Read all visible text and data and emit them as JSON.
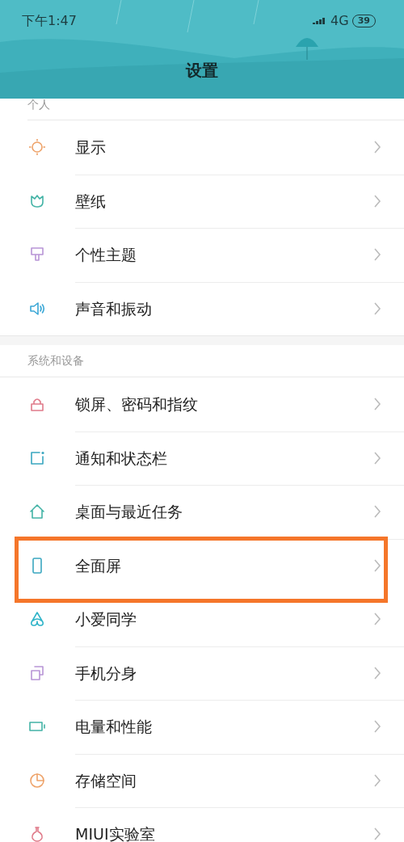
{
  "status_bar": {
    "time": "下午1:47",
    "network": "4G",
    "battery": "39"
  },
  "title": "设置",
  "sections": [
    {
      "label": "个人",
      "items": [
        {
          "label": "显示",
          "highlighted": false
        },
        {
          "label": "壁纸",
          "highlighted": false
        },
        {
          "label": "个性主题",
          "highlighted": false
        },
        {
          "label": "声音和振动",
          "highlighted": false
        }
      ]
    },
    {
      "label": "系统和设备",
      "items": [
        {
          "label": "锁屏、密码和指纹",
          "highlighted": false
        },
        {
          "label": "通知和状态栏",
          "highlighted": false
        },
        {
          "label": "桌面与最近任务",
          "highlighted": false
        },
        {
          "label": "全面屏",
          "highlighted": true
        },
        {
          "label": "小爱同学",
          "highlighted": false
        },
        {
          "label": "手机分身",
          "highlighted": false
        },
        {
          "label": "电量和性能",
          "highlighted": false
        },
        {
          "label": "存储空间",
          "highlighted": false
        },
        {
          "label": "MIUI实验室",
          "highlighted": false
        }
      ]
    }
  ]
}
